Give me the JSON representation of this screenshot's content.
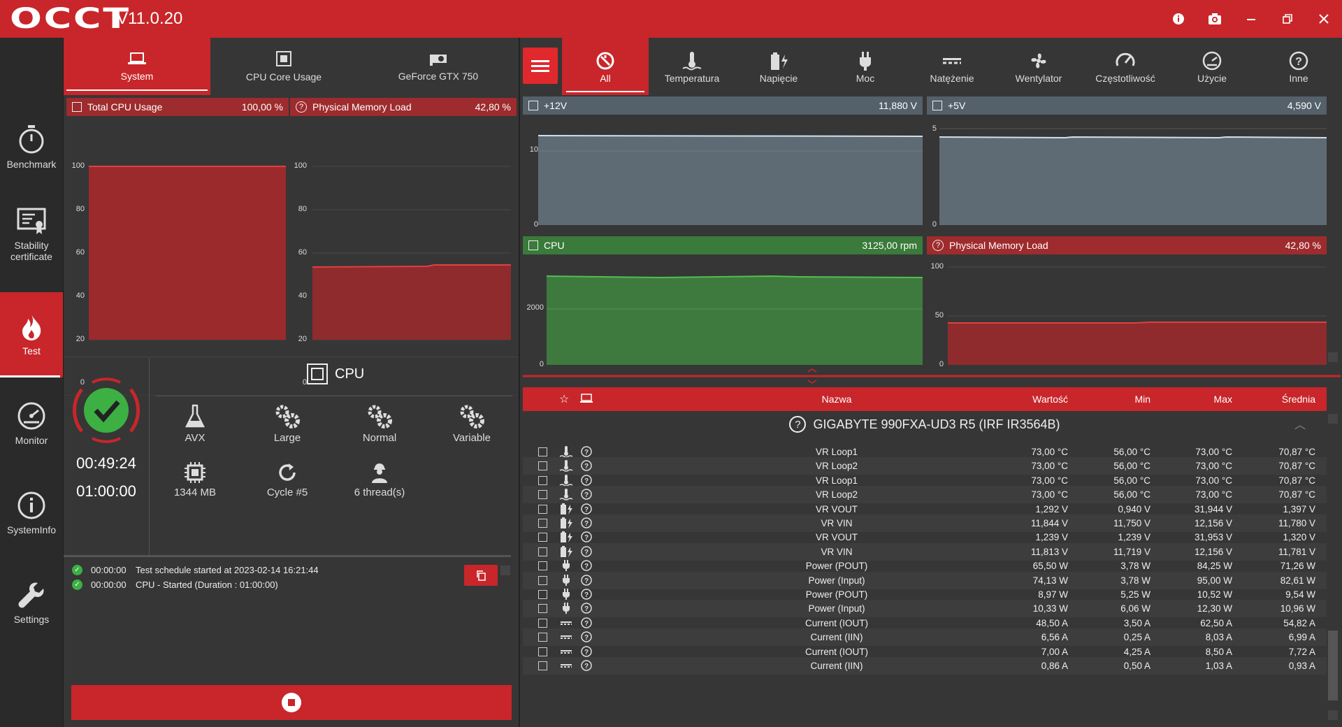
{
  "app": {
    "logo": "OCCT",
    "version": "V11.0.20"
  },
  "window_controls": [
    "info-icon",
    "camera-icon",
    "minimize-icon",
    "restore-icon",
    "close-icon"
  ],
  "nav": [
    {
      "label": "Benchmark",
      "icon": "stopwatch-icon"
    },
    {
      "label": "Stability certificate",
      "icon": "certificate-icon"
    },
    {
      "label": "Test",
      "icon": "flame-icon",
      "active": true
    },
    {
      "label": "Monitor",
      "icon": "gauge-icon"
    },
    {
      "label": "SystemInfo",
      "icon": "info-icon"
    },
    {
      "label": "Settings",
      "icon": "wrench-icon"
    }
  ],
  "left_tabs": [
    {
      "label": "System",
      "active": true
    },
    {
      "label": "CPU Core Usage"
    },
    {
      "label": "GeForce GTX 750"
    }
  ],
  "left_charts": {
    "cpu": {
      "title": "Total CPU Usage",
      "value": "100,00 %",
      "ticks": [
        "100",
        "80",
        "60",
        "40",
        "20",
        "0"
      ]
    },
    "mem": {
      "title": "Physical Memory Load",
      "value": "42,80 %",
      "ticks": [
        "100",
        "80",
        "60",
        "40",
        "20",
        "0"
      ]
    }
  },
  "test": {
    "title": "CPU",
    "elapsed": "00:49:24",
    "duration": "01:00:00",
    "options": [
      {
        "label": "AVX",
        "icon": "flask-icon"
      },
      {
        "label": "Large",
        "icon": "gears-icon"
      },
      {
        "label": "Normal",
        "icon": "gears-icon"
      },
      {
        "label": "Variable",
        "icon": "gears-icon"
      },
      {
        "label": "1344 MB",
        "icon": "chip-icon"
      },
      {
        "label": "Cycle #5",
        "icon": "refresh-icon"
      },
      {
        "label": "6 thread(s)",
        "icon": "worker-icon"
      }
    ],
    "log": [
      {
        "time": "00:00:00",
        "text": "Test schedule started at 2023-02-14 16:21:44"
      },
      {
        "time": "00:00:00",
        "text": "CPU - Started (Duration : 01:00:00)"
      }
    ]
  },
  "right_tabs": [
    {
      "label": "All",
      "icon": "all-icon",
      "active": true
    },
    {
      "label": "Temperatura",
      "icon": "thermometer-icon"
    },
    {
      "label": "Napięcie",
      "icon": "battery-bolt-icon"
    },
    {
      "label": "Moc",
      "icon": "plug-icon"
    },
    {
      "label": "Natężenie",
      "icon": "current-icon"
    },
    {
      "label": "Wentylator",
      "icon": "fan-icon"
    },
    {
      "label": "Częstotliwość",
      "icon": "speedometer-icon"
    },
    {
      "label": "Użycie",
      "icon": "gauge-icon"
    },
    {
      "label": "Inne",
      "icon": "question-icon"
    }
  ],
  "right_charts": [
    {
      "title": "+12V",
      "value": "11,880 V",
      "ticks": [
        "10",
        "0"
      ],
      "style": "gray"
    },
    {
      "title": "+5V",
      "value": "4,590 V",
      "ticks": [
        "5",
        "0"
      ],
      "style": "gray"
    },
    {
      "title": "CPU",
      "value": "3125,00 rpm",
      "ticks": [
        "2000",
        "0"
      ],
      "style": "green"
    },
    {
      "title": "Physical Memory Load",
      "value": "42,80 %",
      "ticks": [
        "100",
        "50",
        "0"
      ],
      "style": "red"
    }
  ],
  "table": {
    "headers": {
      "name": "Nazwa",
      "value": "Wartość",
      "min": "Min",
      "max": "Max",
      "avg": "Średnia"
    },
    "group": "GIGABYTE 990FXA-UD3 R5 (IRF IR3564B)",
    "rows": [
      {
        "icon": "thermometer-icon",
        "name": "VR Loop1",
        "value": "73,00 °C",
        "min": "56,00 °C",
        "max": "73,00 °C",
        "avg": "70,87 °C"
      },
      {
        "icon": "thermometer-icon",
        "name": "VR Loop2",
        "value": "73,00 °C",
        "min": "56,00 °C",
        "max": "73,00 °C",
        "avg": "70,87 °C"
      },
      {
        "icon": "thermometer-icon",
        "name": "VR Loop1",
        "value": "73,00 °C",
        "min": "56,00 °C",
        "max": "73,00 °C",
        "avg": "70,87 °C"
      },
      {
        "icon": "thermometer-icon",
        "name": "VR Loop2",
        "value": "73,00 °C",
        "min": "56,00 °C",
        "max": "73,00 °C",
        "avg": "70,87 °C"
      },
      {
        "icon": "battery-bolt-icon",
        "name": "VR VOUT",
        "value": "1,292 V",
        "min": "0,940 V",
        "max": "31,944 V",
        "avg": "1,397 V"
      },
      {
        "icon": "battery-bolt-icon",
        "name": "VR VIN",
        "value": "11,844 V",
        "min": "11,750 V",
        "max": "12,156 V",
        "avg": "11,780 V"
      },
      {
        "icon": "battery-bolt-icon",
        "name": "VR VOUT",
        "value": "1,239 V",
        "min": "1,239 V",
        "max": "31,953 V",
        "avg": "1,320 V"
      },
      {
        "icon": "battery-bolt-icon",
        "name": "VR VIN",
        "value": "11,813 V",
        "min": "11,719 V",
        "max": "12,156 V",
        "avg": "11,781 V"
      },
      {
        "icon": "plug-icon",
        "name": "Power (POUT)",
        "value": "65,50 W",
        "min": "3,78 W",
        "max": "84,25 W",
        "avg": "71,26 W"
      },
      {
        "icon": "plug-icon",
        "name": "Power (Input)",
        "value": "74,13 W",
        "min": "3,78 W",
        "max": "95,00 W",
        "avg": "82,61 W"
      },
      {
        "icon": "plug-icon",
        "name": "Power (POUT)",
        "value": "8,97 W",
        "min": "5,25 W",
        "max": "10,52 W",
        "avg": "9,54 W"
      },
      {
        "icon": "plug-icon",
        "name": "Power (Input)",
        "value": "10,33 W",
        "min": "6,06 W",
        "max": "12,30 W",
        "avg": "10,96 W"
      },
      {
        "icon": "current-icon",
        "name": "Current (IOUT)",
        "value": "48,50 A",
        "min": "3,50 A",
        "max": "62,50 A",
        "avg": "54,82 A"
      },
      {
        "icon": "current-icon",
        "name": "Current (IIN)",
        "value": "6,56 A",
        "min": "0,25 A",
        "max": "8,03 A",
        "avg": "6,99 A"
      },
      {
        "icon": "current-icon",
        "name": "Current (IOUT)",
        "value": "7,00 A",
        "min": "4,25 A",
        "max": "8,50 A",
        "avg": "7,72 A"
      },
      {
        "icon": "current-icon",
        "name": "Current (IIN)",
        "value": "0,86 A",
        "min": "0,50 A",
        "max": "1,03 A",
        "avg": "0,93 A"
      }
    ]
  },
  "colors": {
    "accent": "#c8262a",
    "panel": "#363636",
    "ok": "#3cb043"
  }
}
